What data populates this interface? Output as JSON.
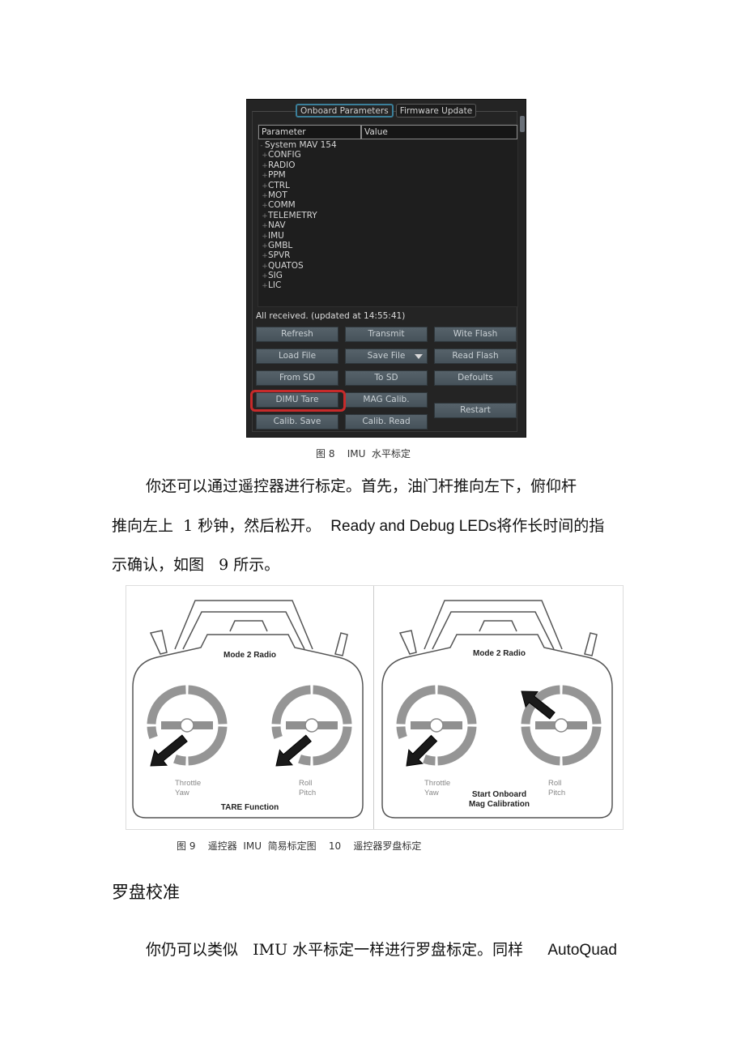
{
  "app": {
    "tabs": [
      {
        "label": "Onboard Parameters",
        "active": true
      },
      {
        "label": "Firmware Update",
        "active": false
      }
    ],
    "table": {
      "columns": [
        "Parameter",
        "Value"
      ],
      "root": {
        "expander": "-",
        "label": "System MAV 154"
      },
      "groups": [
        {
          "expander": "+",
          "label": "CONFIG"
        },
        {
          "expander": "+",
          "label": "RADIO"
        },
        {
          "expander": "+",
          "label": "PPM"
        },
        {
          "expander": "+",
          "label": "CTRL"
        },
        {
          "expander": "+",
          "label": "MOT"
        },
        {
          "expander": "+",
          "label": "COMM"
        },
        {
          "expander": "+",
          "label": "TELEMETRY"
        },
        {
          "expander": "+",
          "label": "NAV"
        },
        {
          "expander": "+",
          "label": "IMU"
        },
        {
          "expander": "+",
          "label": "GMBL"
        },
        {
          "expander": "+",
          "label": "SPVR"
        },
        {
          "expander": "+",
          "label": "QUATOS"
        },
        {
          "expander": "+",
          "label": "SIG"
        },
        {
          "expander": "+",
          "label": "LIC"
        }
      ]
    },
    "status": "All received. (updated at 14:55:41)",
    "buttons": {
      "refresh": "Refresh",
      "transmit": "Transmit",
      "write_flash": "Wite Flash",
      "load_file": "Load File",
      "save_file": "Save File",
      "read_flash": "Read Flash",
      "from_sd": "From SD",
      "to_sd": "To SD",
      "defaults": "Defoults",
      "dimu_tare": "DIMU Tare",
      "mag_calib": "MAG Calib.",
      "restart": "Restart",
      "calib_save": "Calib. Save",
      "calib_read": "Calib. Read"
    },
    "highlight_color": "#c72a2a",
    "accent_color": "#3b7f9a"
  },
  "doc": {
    "fig8_caption": "图 8    IMU  水平标定",
    "para1": {
      "line1": "你还可以通过遥控器进行标定。首先，油门杆推向左下，俯仰杆",
      "line2_a": "推向左上  1 秒钟，然后松开。  ",
      "line2_latin": "Ready and Debug LEDs",
      "line2_b": "将作长时间的指",
      "line3": "示确认，如图   9 所示。"
    },
    "fig9_caption": "图 9    遥控器  IMU  简易标定图    10    遥控器罗盘标定",
    "heading": "罗盘校准",
    "para2": {
      "text": "你仍可以类似   IMU 水平标定一样进行罗盘标定。同样     ",
      "latin": "AutoQuad"
    }
  },
  "figures": {
    "left": {
      "title": "Mode 2 Radio",
      "left_stick_label": "Throttle\nYaw",
      "right_stick_label": "Roll\nPitch",
      "function": "TARE Function"
    },
    "right": {
      "title": "Mode 2 Radio",
      "left_stick_label": "Throttle\nYaw",
      "right_stick_label": "Roll\nPitch",
      "function": "Start Onboard\nMag Calibration"
    }
  }
}
